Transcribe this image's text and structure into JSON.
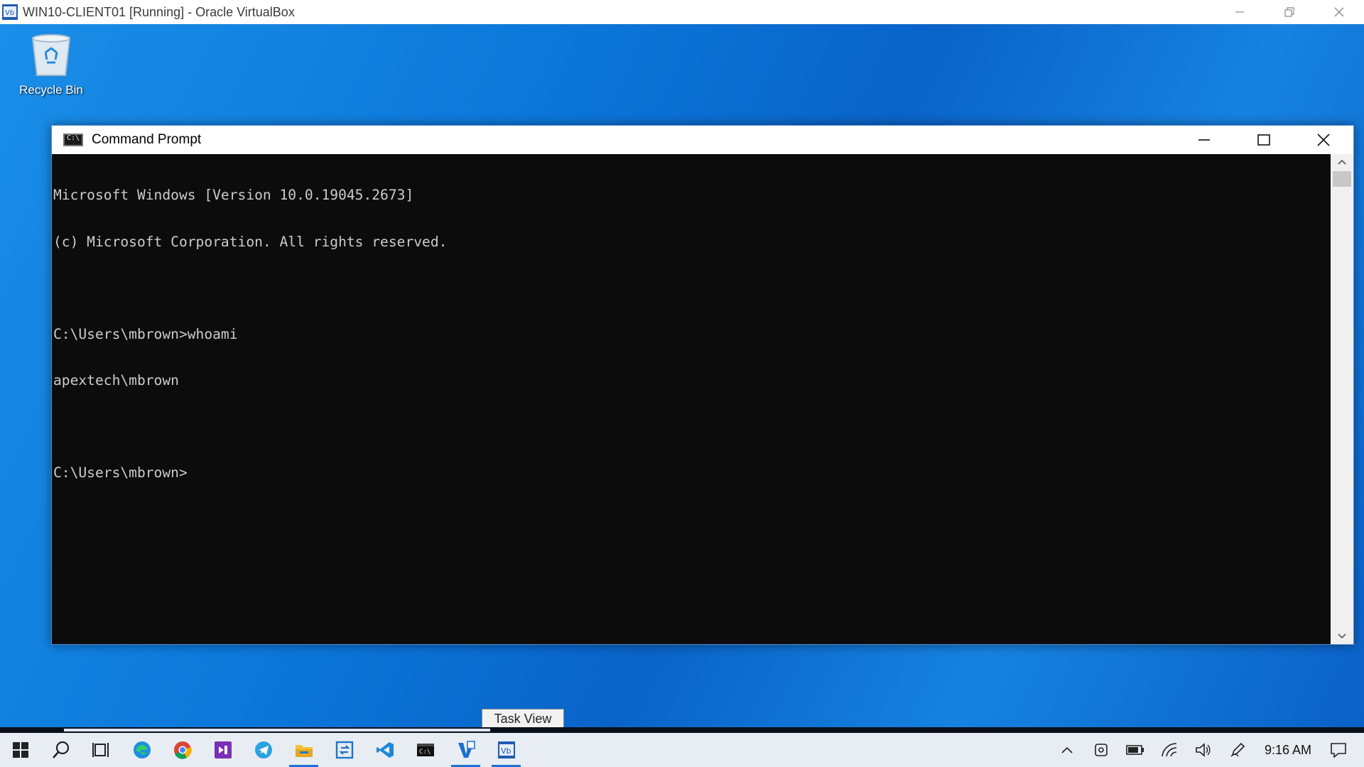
{
  "host": {
    "title": "WIN10-CLIENT01 [Running] - Oracle VirtualBox"
  },
  "desktop": {
    "recycle_bin_label": "Recycle Bin"
  },
  "cmd": {
    "title": "Command Prompt",
    "icon_text": "C:\\",
    "lines": [
      "Microsoft Windows [Version 10.0.19045.2673]",
      "(c) Microsoft Corporation. All rights reserved.",
      "",
      "C:\\Users\\mbrown>whoami",
      "apextech\\mbrown",
      "",
      "C:\\Users\\mbrown>"
    ]
  },
  "taskbar": {
    "tooltip": "Task View",
    "clock": "9:16 AM",
    "apps": [
      "start-icon",
      "search-icon",
      "task-view-icon",
      "edge-icon",
      "chrome-icon",
      "visual-studio-icon",
      "telegram-icon",
      "file-explorer-icon",
      "remote-desktop-icon",
      "vscode-icon",
      "terminal-icon",
      "virtualbox-vm-icon",
      "virtualbox-icon"
    ]
  },
  "colors": {
    "accent": "#1a73d6",
    "terminal_bg": "#0c0c0c",
    "terminal_fg": "#cccccc"
  }
}
